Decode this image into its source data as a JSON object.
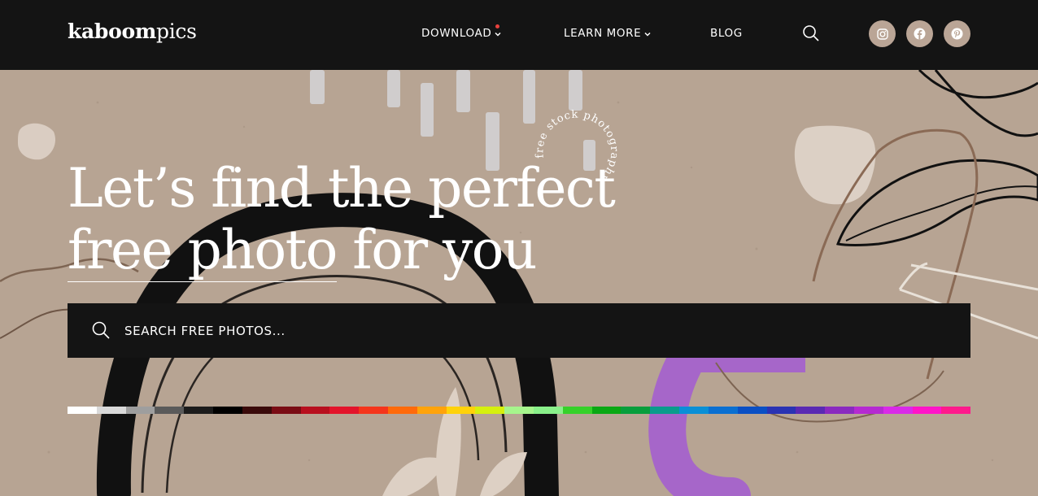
{
  "header": {
    "logo_bold": "kaboom",
    "logo_light": "pics",
    "nav": {
      "download": "DOWNLOAD",
      "learn_more": "LEARN MORE",
      "blog": "BLOG"
    },
    "icons": [
      "search-icon",
      "instagram-icon",
      "facebook-icon",
      "pinterest-icon",
      "chevron-down-icon"
    ]
  },
  "hero": {
    "headline_line1": "Let’s find the perfect",
    "headline_underlined": "free photo",
    "headline_rest": " for you",
    "badge_text": "free stock photography",
    "search_placeholder": "SEARCH FREE PHOTOS..."
  },
  "colors": {
    "header_bg": "#141414",
    "hero_bg": "#b7a493",
    "social_bg": "#baa596",
    "notification_dot": "#e8413d",
    "palette": [
      "#ffffff",
      "#d9d9d9",
      "#9e9e9e",
      "#5a5a5a",
      "#1c1c1c",
      "#000000",
      "#3a0a0a",
      "#7a0c14",
      "#b80f1e",
      "#e3142b",
      "#f5351c",
      "#ff6a0a",
      "#ffa30a",
      "#ffd20a",
      "#d6f00e",
      "#a6f58c",
      "#8af08a",
      "#36d12a",
      "#0aa814",
      "#079e3c",
      "#0a9c8c",
      "#0a8fd6",
      "#0a6fd1",
      "#0a4fc4",
      "#2a33b3",
      "#5a2ab3",
      "#8a2abf",
      "#b52ad1",
      "#d92ae8",
      "#ff14c8",
      "#ff1a8c"
    ]
  }
}
